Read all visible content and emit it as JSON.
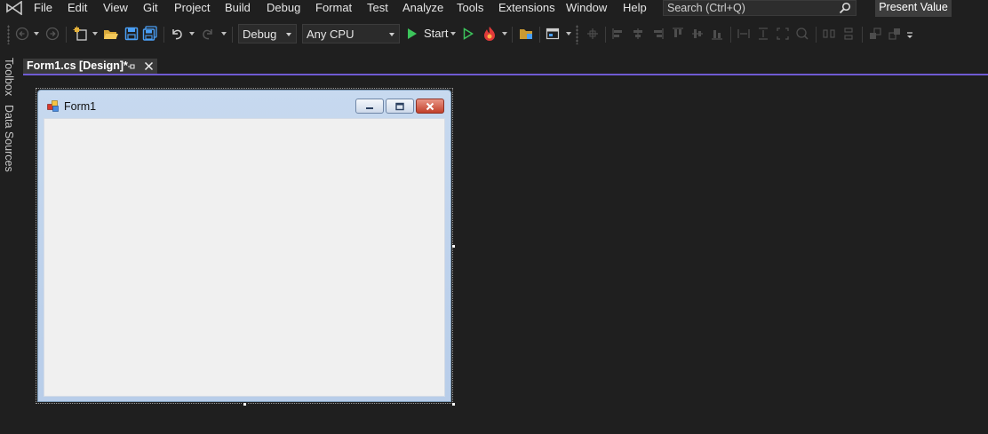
{
  "menubar": {
    "logo_icon": "visual-studio-logo-icon",
    "items": [
      "File",
      "Edit",
      "View",
      "Git",
      "Project",
      "Build",
      "Debug",
      "Format",
      "Test",
      "Analyze",
      "Tools",
      "Extensions",
      "Window",
      "Help"
    ],
    "search": {
      "text": "Search (Ctrl+Q)",
      "icon": "search-icon"
    },
    "present_value": "Present Value"
  },
  "toolbar": {
    "configuration": "Debug",
    "platform": "Any CPU",
    "start_label": "Start",
    "icons": [
      "back-icon",
      "forward-icon",
      "new-project-icon",
      "open-folder-icon",
      "save-icon",
      "save-all-icon",
      "undo-icon",
      "redo-icon",
      "start-icon",
      "start-without-debugging-icon",
      "hot-reload-icon",
      "solution-explorer-icon",
      "layout-icon",
      "align-icons"
    ]
  },
  "left_rail": {
    "tabs": [
      "Toolbox",
      "Data Sources"
    ]
  },
  "document_tab": {
    "label": "Form1.cs [Design]*"
  },
  "form": {
    "title": "Form1"
  },
  "colors": {
    "background": "#1f1f1f",
    "accent": "#6f5bd3",
    "form_client": "#f0f0f0",
    "close_button": "#c2402a"
  }
}
